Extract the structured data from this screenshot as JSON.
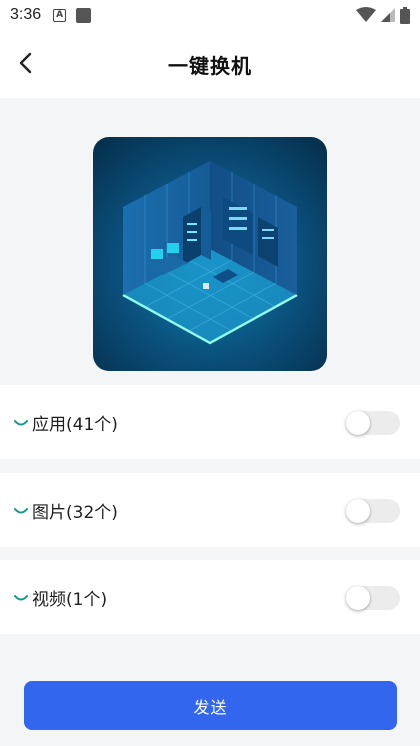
{
  "status_bar": {
    "time": "3:36",
    "a_icon": "A"
  },
  "header": {
    "title": "一键换机"
  },
  "items": [
    {
      "label": "应用(41个)",
      "enabled": false
    },
    {
      "label": "图片(32个)",
      "enabled": false
    },
    {
      "label": "视频(1个)",
      "enabled": false
    }
  ],
  "send_button": {
    "label": "发送"
  },
  "colors": {
    "accent": "#3366ee",
    "spinner": "#11998e",
    "toggle_off": "#ececec"
  }
}
